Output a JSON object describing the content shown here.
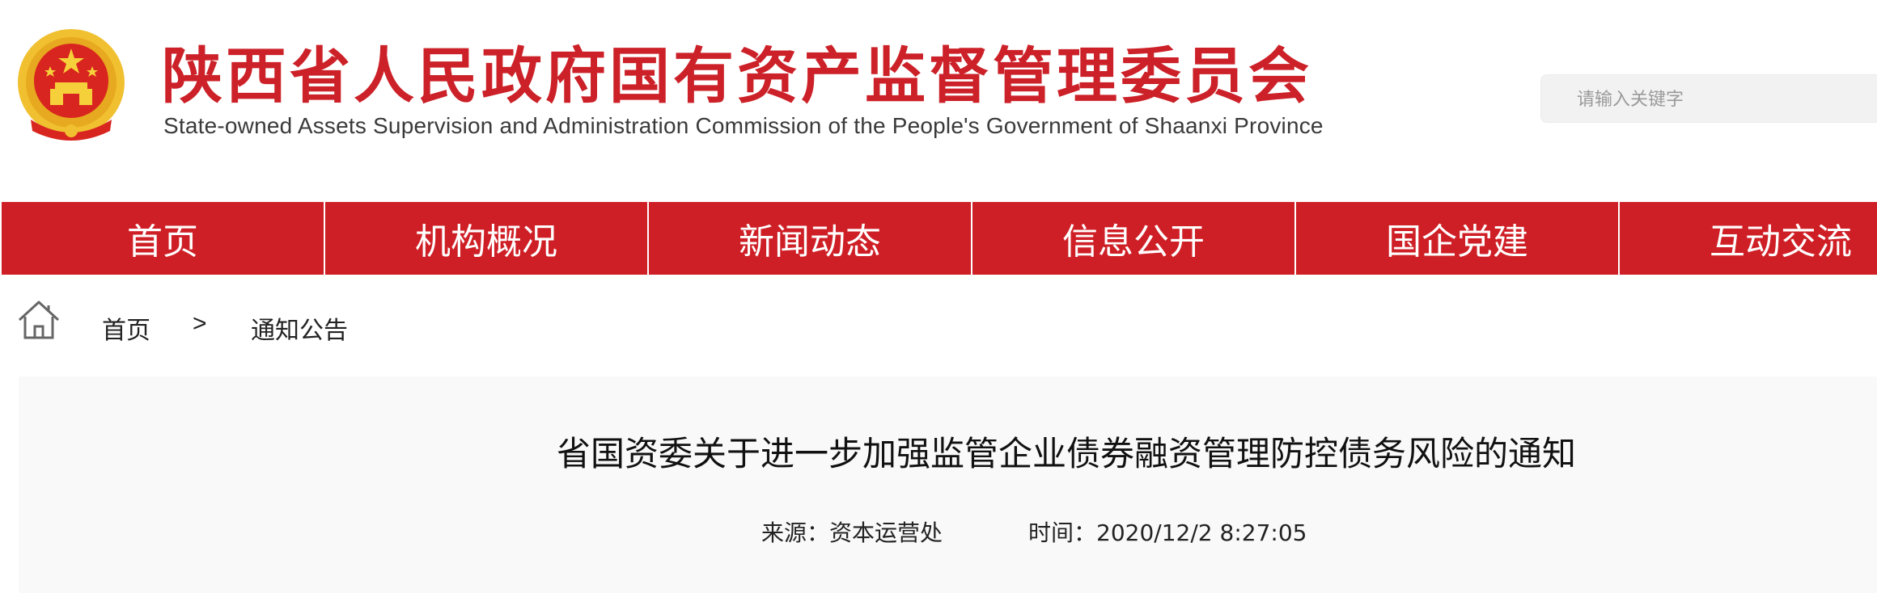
{
  "header": {
    "title_cn": "陕西省人民政府国有资产监督管理委员会",
    "title_en": "State-owned Assets Supervision and Administration Commission of the People's Government of Shaanxi Province",
    "emblem_icon": "national-emblem-icon",
    "search": {
      "placeholder": "请输入关键字",
      "value": ""
    }
  },
  "nav": {
    "items": [
      "首页",
      "机构概况",
      "新闻动态",
      "信息公开",
      "国企党建",
      "互动交流"
    ]
  },
  "breadcrumb": {
    "home_icon": "home-icon",
    "home": "首页",
    "separator": ">",
    "current": "通知公告"
  },
  "article": {
    "title": "省国资委关于进一步加强监管企业债券融资管理防控债务风险的通知",
    "source_label": "来源：",
    "source": "资本运营处",
    "time_label": "时间：",
    "time": "2020/12/2 8:27:05"
  },
  "colors": {
    "brand_red": "#cf1f26",
    "emblem_gold": "#f0c030",
    "article_bg": "#f9f9f9"
  }
}
